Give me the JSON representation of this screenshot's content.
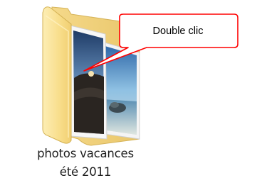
{
  "folder": {
    "name_line1": "photos vacances",
    "name_line2": "été 2011",
    "icon": "folder-icon"
  },
  "callout": {
    "text": "Double clic",
    "fill": "#ffffff",
    "stroke": "#ff0000"
  },
  "colors": {
    "folder_light": "#fbe8a2",
    "folder_dark": "#e6c35d",
    "label_text": "#1e1e1e"
  }
}
